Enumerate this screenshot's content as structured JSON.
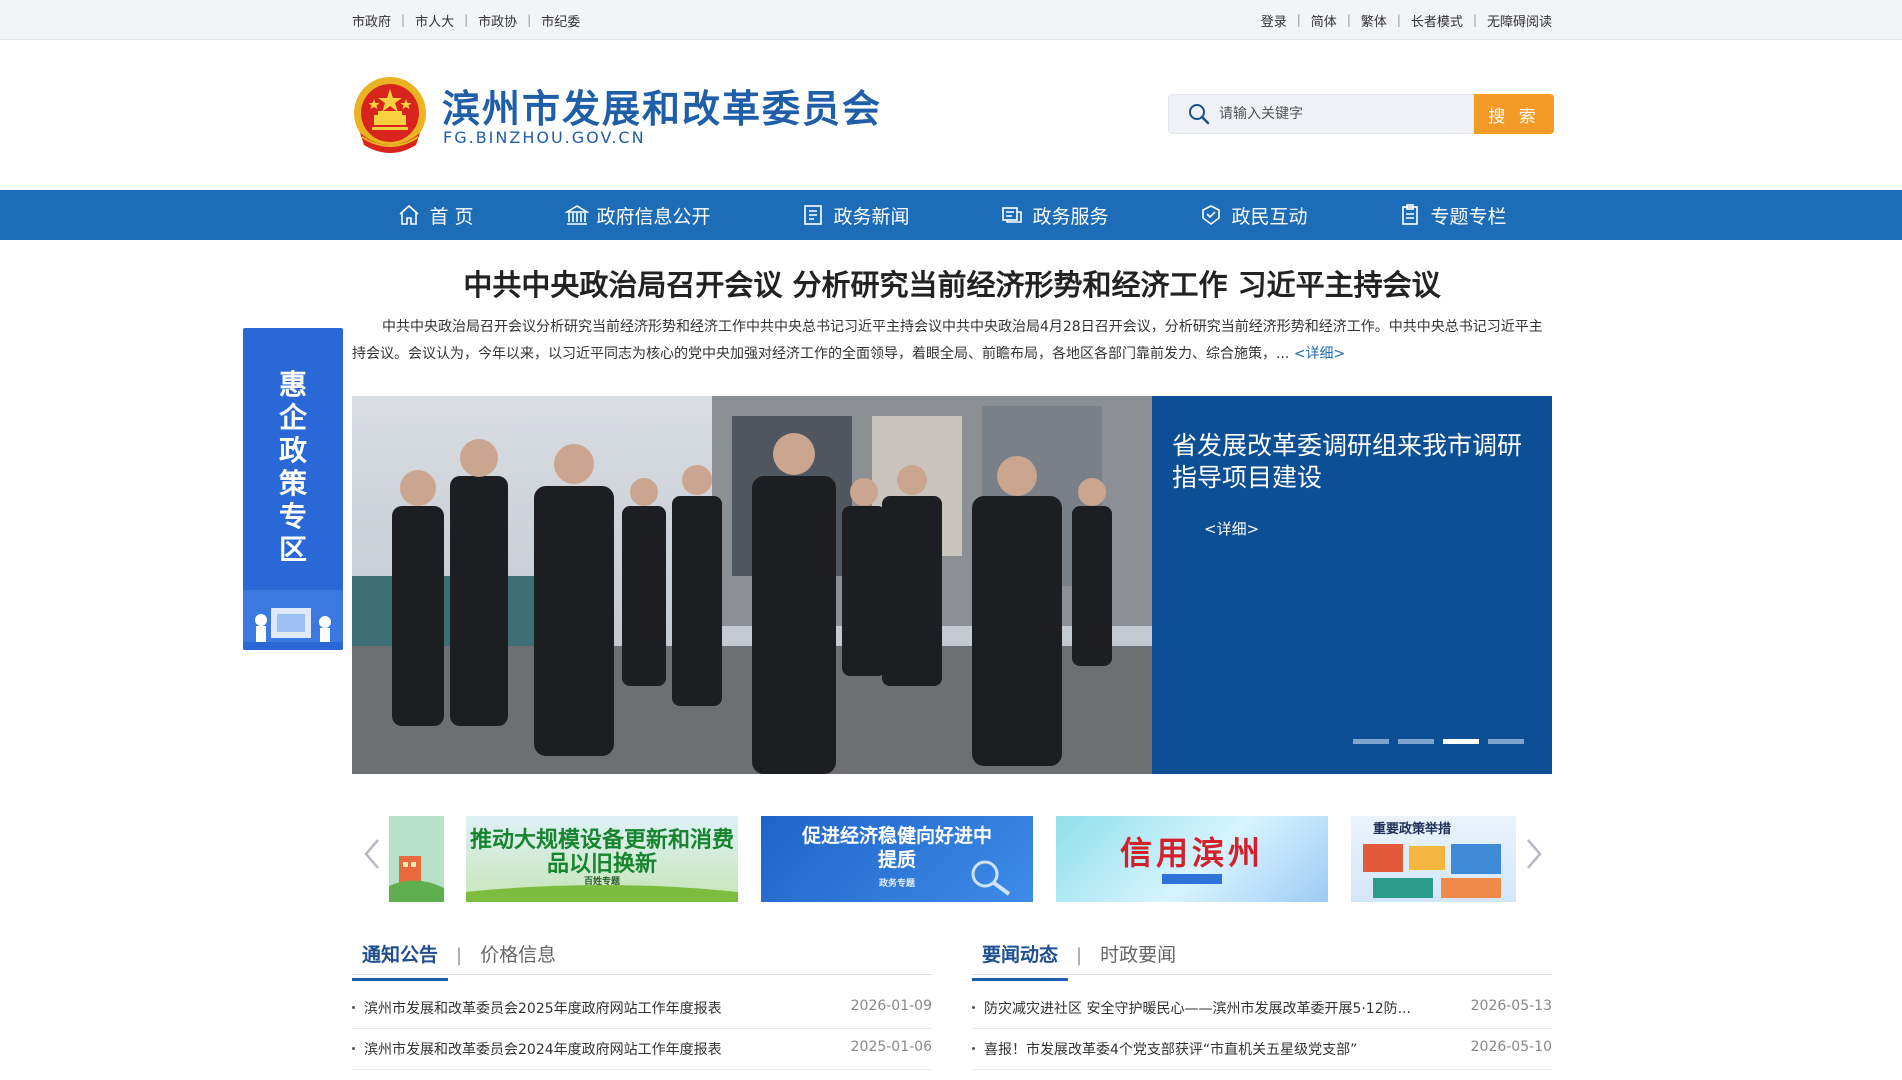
{
  "topbar": {
    "left_links": [
      "市政府",
      "市人大",
      "市政协",
      "市纪委"
    ],
    "right_links": [
      "登录",
      "简体",
      "繁体",
      "长者模式",
      "无障碍阅读"
    ]
  },
  "header": {
    "title": "滨州市发展和改革委员会",
    "domain": "FG.BINZHOU.GOV.CN",
    "search_placeholder": "请输入关键字",
    "search_button": "搜 索"
  },
  "nav": {
    "items": [
      {
        "label": "首 页",
        "icon": "home-icon"
      },
      {
        "label": "政府信息公开",
        "icon": "government-building-icon"
      },
      {
        "label": "政务新闻",
        "icon": "news-document-icon"
      },
      {
        "label": "政务服务",
        "icon": "service-icon"
      },
      {
        "label": "政民互动",
        "icon": "interaction-icon"
      },
      {
        "label": "专题专栏",
        "icon": "clipboard-icon"
      }
    ]
  },
  "headline": {
    "title": "中共中央政治局召开会议 分析研究当前经济形势和经济工作 习近平主持会议",
    "summary": "中共中央政治局召开会议分析研究当前经济形势和经济工作中共中央总书记习近平主持会议中共中央政治局4月28日召开会议，分析研究当前经济形势和经济工作。中共中央总书记习近平主持会议。会议认为，今年以来，以习近平同志为核心的党中央加强对经济工作的全面领导，着眼全局、前瞻布局，各地区各部门靠前发力、综合施策，...",
    "more": "<详细>"
  },
  "side_float": {
    "text": "惠企政策专区"
  },
  "carousel": {
    "caption": "省发展改革委调研组来我市调研指导项目建设",
    "more": "<详细>",
    "slide_count": 4,
    "active_index": 2
  },
  "banners": [
    {
      "text": "推动大规模设备更新和消费品以旧换新",
      "sub": "百姓专题"
    },
    {
      "text": "促进经济稳健向好进中提质",
      "sub": "政务专题"
    },
    {
      "text": "信用滨州",
      "sub": ""
    },
    {
      "text": "重要政策举措",
      "sub": ""
    }
  ],
  "left_panel": {
    "tabs": [
      "通知公告",
      "价格信息"
    ],
    "items": [
      {
        "title": "滨州市发展和改革委员会2025年度政府网站工作年度报表",
        "date": "2026-01-09"
      },
      {
        "title": "滨州市发展和改革委员会2024年度政府网站工作年度报表",
        "date": "2025-01-06"
      }
    ]
  },
  "right_panel": {
    "tabs": [
      "要闻动态",
      "时政要闻"
    ],
    "items": [
      {
        "title": "防灾减灾进社区 安全守护暖民心——滨州市发展改革委开展5·12防...",
        "date": "2026-05-13"
      },
      {
        "title": "喜报！市发展改革委4个党支部获评“市直机关五星级党支部”",
        "date": "2026-05-10"
      }
    ]
  },
  "colors": {
    "brand_blue": "#1c6cb8",
    "title_blue": "#1f5ea8",
    "search_orange": "#f39a27",
    "caption_panel": "#0d4f94"
  }
}
